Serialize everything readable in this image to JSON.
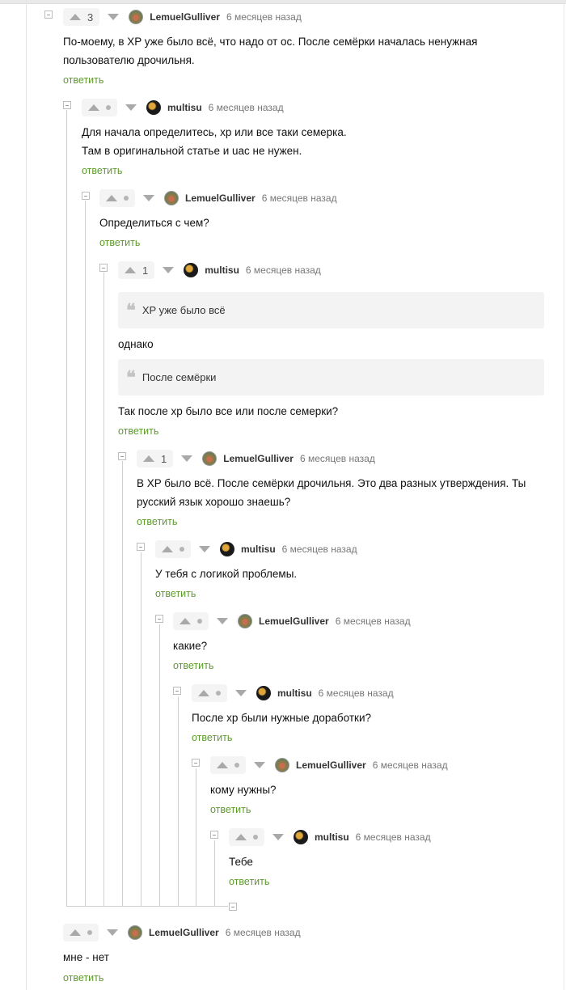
{
  "comments": [
    {
      "author": "LemuelGulliver",
      "time": "6 месяцев назад",
      "votes": "3",
      "lines": [
        "По-моему, в XP уже было всё, что надо от ос. После семёрки началась ненужная",
        "пользователю дрочильня."
      ],
      "reply": "ответить"
    },
    {
      "author": "multisu",
      "time": "6 месяцев назад",
      "votes": "",
      "lines": [
        "Для начала определитесь, xp или все таки семерка.",
        "Там в оригинальной статье и uac не нужен."
      ],
      "reply": "ответить"
    },
    {
      "author": "LemuelGulliver",
      "time": "6 месяцев назад",
      "votes": "",
      "lines": [
        "Определиться с чем?"
      ],
      "reply": "ответить"
    },
    {
      "author": "multisu",
      "time": "6 месяцев назад",
      "votes": "1",
      "quote1": "XP уже было всё",
      "mid": "однако",
      "quote2": "После семёрки",
      "after": "Так после хр было все или после семерки?",
      "reply": "ответить"
    },
    {
      "author": "LemuelGulliver",
      "time": "6 месяцев назад",
      "votes": "1",
      "lines": [
        "В XP было всё. После семёрки дрочильня. Это два разных утверждения. Ты",
        "русский язык хорошо знаешь?"
      ],
      "reply": "ответить"
    },
    {
      "author": "multisu",
      "time": "6 месяцев назад",
      "votes": "",
      "lines": [
        "У тебя с логикой проблемы."
      ],
      "reply": "ответить"
    },
    {
      "author": "LemuelGulliver",
      "time": "6 месяцев назад",
      "votes": "",
      "lines": [
        "какие?"
      ],
      "reply": "ответить"
    },
    {
      "author": "multisu",
      "time": "6 месяцев назад",
      "votes": "",
      "lines": [
        "После хр были нужные доработки?"
      ],
      "reply": "ответить"
    },
    {
      "author": "LemuelGulliver",
      "time": "6 месяцев назад",
      "votes": "",
      "lines": [
        "кому нужны?"
      ],
      "reply": "ответить"
    },
    {
      "author": "multisu",
      "time": "6 месяцев назад",
      "votes": "",
      "lines": [
        "Тебе"
      ],
      "reply": "ответить"
    },
    {
      "author": "LemuelGulliver",
      "time": "6 месяцев назад",
      "votes": "",
      "lines": [
        "мне - нет"
      ],
      "reply": "ответить"
    }
  ]
}
